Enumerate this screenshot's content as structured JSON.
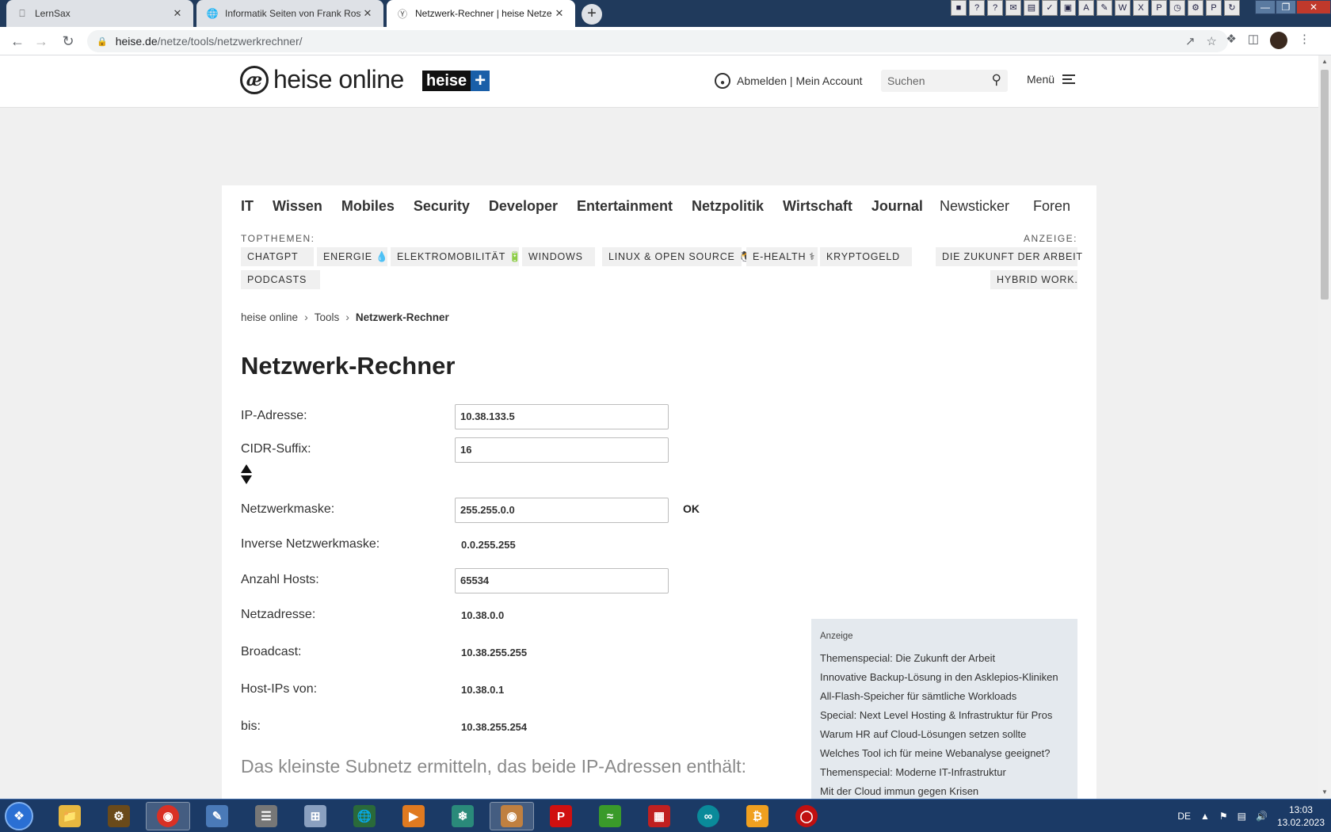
{
  "browser": {
    "tabs": [
      {
        "label": "LernSax",
        "icon": "laptop-icon",
        "active": false
      },
      {
        "label": "Informatik Seiten von Frank Rost",
        "icon": "globe-icon",
        "active": false
      },
      {
        "label": "Netzwerk-Rechner | heise Netze",
        "icon": "heise-icon",
        "active": true
      }
    ],
    "url_host": "heise.de",
    "url_path": "/netze/tools/netzwerkrechner/"
  },
  "header": {
    "logo_mark": "æ",
    "logo_text": "heise online",
    "plus_word": "heise",
    "plus_sign": "+",
    "account_text": "Abmelden | Mein Account",
    "search_placeholder": "Suchen",
    "menu_label": "Menü"
  },
  "nav": {
    "items": [
      "IT",
      "Wissen",
      "Mobiles",
      "Security",
      "Developer",
      "Entertainment",
      "Netzpolitik",
      "Wirtschaft",
      "Journal"
    ],
    "right_items": [
      "Newsticker",
      "Foren"
    ]
  },
  "topthemen": {
    "label": "TOPTHEMEN:",
    "anzeige_label": "ANZEIGE:",
    "pills": [
      "CHATGPT",
      "ENERGIE 💧",
      "ELEKTROMOBILITÄT 🔋",
      "WINDOWS",
      "LINUX & OPEN SOURCE 🐧",
      "E-HEALTH ⚕",
      "KRYPTOGELD",
      "PODCASTS"
    ],
    "ad_pills": [
      "DIE ZUKUNFT DER ARBEIT",
      "HYBRID WORK."
    ]
  },
  "breadcrumb": {
    "items": [
      "heise online",
      "Tools"
    ],
    "current": "Netzwerk-Rechner",
    "separator": "›"
  },
  "calculator": {
    "title": "Netzwerk-Rechner",
    "ip_label": "IP-Adresse:",
    "ip_value": "10.38.133.5",
    "cidr_label": "CIDR-Suffix:",
    "cidr_value": "16",
    "mask_label": "Netzwerkmaske:",
    "mask_value": "255.255.0.0",
    "ok_label": "OK",
    "inverse_label": "Inverse Netzwerkmaske:",
    "inverse_value": "0.0.255.255",
    "hosts_label": "Anzahl Hosts:",
    "hosts_value": "65534",
    "netaddr_label": "Netzadresse:",
    "netaddr_value": "10.38.0.0",
    "broadcast_label": "Broadcast:",
    "broadcast_value": "10.38.255.255",
    "hostfrom_label": "Host-IPs von:",
    "hostfrom_value": "10.38.0.1",
    "hostto_label": "bis:",
    "hostto_value": "10.38.255.254",
    "subnet_heading": "Das kleinste Subnetz ermitteln, das beide IP-Adressen enthält:"
  },
  "ad": {
    "label": "Anzeige",
    "links": [
      "Themenspecial: Die Zukunft der Arbeit",
      "Innovative Backup-Lösung in den Asklepios-Kliniken",
      "All-Flash-Speicher für sämtliche Workloads",
      "Special: Next Level Hosting & Infrastruktur für Pros",
      "Warum HR auf Cloud-Lösungen setzen sollte",
      "Welches Tool ich für meine Webanalyse geeignet?",
      "Themenspecial: Moderne IT-Infrastruktur",
      "Mit der Cloud immun gegen Krisen"
    ]
  },
  "taskbar": {
    "language": "DE",
    "time": "13:03",
    "date": "13.02.2023"
  },
  "colors": {
    "accent_blue": "#1a5fa8",
    "tabbar": "#203a5c",
    "taskbar": "#1b3a66",
    "ad_background": "#e4e9ee"
  }
}
